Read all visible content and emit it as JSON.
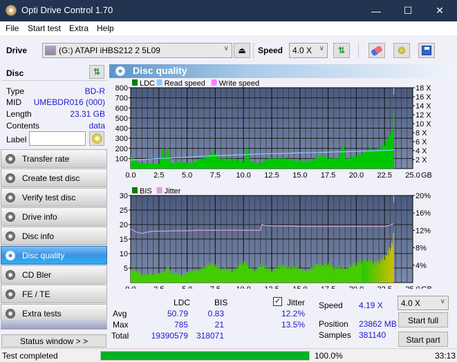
{
  "window": {
    "title": "Opti Drive Control 1.70",
    "minimize": "—",
    "maximize": "☐",
    "close": "✕"
  },
  "menu": [
    "File",
    "Start test",
    "Extra",
    "Help"
  ],
  "toolbar": {
    "drive_label": "Drive",
    "drive_value": "(G:)  ATAPI iHBS212  2 5L09",
    "speed_label": "Speed",
    "speed_value": "4.0 X",
    "icons": [
      "drive-icon",
      "eject-icon",
      "refresh-icon",
      "eraser-icon",
      "settings-icon",
      "save-icon"
    ]
  },
  "disc": {
    "title": "Disc",
    "type_label": "Type",
    "type_value": "BD-R",
    "mid_label": "MID",
    "mid_value": "UMEBDR016 (000)",
    "length_label": "Length",
    "length_value": "23.31 GB",
    "contents_label": "Contents",
    "contents_value": "data",
    "label_label": "Label",
    "label_value": ""
  },
  "nav": [
    {
      "label": "Transfer rate",
      "active": false
    },
    {
      "label": "Create test disc",
      "active": false
    },
    {
      "label": "Verify test disc",
      "active": false
    },
    {
      "label": "Drive info",
      "active": false
    },
    {
      "label": "Disc info",
      "active": false
    },
    {
      "label": "Disc quality",
      "active": true
    },
    {
      "label": "CD Bler",
      "active": false
    },
    {
      "label": "FE / TE",
      "active": false
    },
    {
      "label": "Extra tests",
      "active": false
    }
  ],
  "status_window_label": "Status window > >",
  "panel_title": "Disc quality",
  "chart_data": [
    {
      "type": "bar",
      "title": "LDC chart",
      "legend": [
        "LDC",
        "Read speed",
        "Write speed"
      ],
      "legend_colors": [
        "#008000",
        "#87cefa",
        "#ff80ff"
      ],
      "xlabel": "GB",
      "x_ticks": [
        "0.0",
        "2.5",
        "5.0",
        "7.5",
        "10.0",
        "12.5",
        "15.0",
        "17.5",
        "20.0",
        "22.5",
        "25.0"
      ],
      "xlim": [
        0,
        25
      ],
      "ylim": [
        0,
        800
      ],
      "y_ticks": [
        "100",
        "200",
        "300",
        "400",
        "500",
        "600",
        "700",
        "800"
      ],
      "y2_ticks": [
        "2 X",
        "4 X",
        "6 X",
        "8 X",
        "10 X",
        "12 X",
        "14 X",
        "16 X",
        "18 X"
      ],
      "y2lim": [
        0,
        18
      ],
      "series": [
        {
          "name": "LDC",
          "x": [
            0,
            0.5,
            1,
            1.5,
            2,
            2.5,
            2.8,
            3,
            3.2,
            3.5,
            4,
            4.5,
            5,
            5.5,
            6,
            6.5,
            7,
            7.3,
            7.5,
            8,
            8.5,
            9,
            9.5,
            10,
            10.3,
            10.5,
            11,
            11.5,
            11.8,
            12,
            12.5,
            13,
            13.5,
            14,
            14.5,
            15,
            15.5,
            16,
            16.5,
            17,
            17.5,
            18,
            18.5,
            18.8,
            19,
            19.5,
            20,
            20.5,
            21,
            21.2,
            21.5,
            22,
            22.3,
            22.6,
            23,
            23.2,
            23.31
          ],
          "values": [
            150,
            80,
            60,
            70,
            65,
            70,
            310,
            80,
            320,
            70,
            75,
            90,
            70,
            100,
            130,
            140,
            170,
            220,
            160,
            130,
            140,
            150,
            110,
            90,
            280,
            90,
            80,
            70,
            130,
            140,
            150,
            130,
            120,
            110,
            100,
            120,
            110,
            130,
            140,
            160,
            120,
            140,
            170,
            420,
            130,
            150,
            160,
            170,
            240,
            280,
            250,
            300,
            350,
            380,
            450,
            500,
            785
          ]
        },
        {
          "name": "Read speed",
          "x": [
            0,
            1,
            2,
            3,
            4,
            5,
            6,
            7,
            8,
            9,
            10,
            11,
            12,
            13,
            14,
            15,
            16,
            17,
            18,
            19,
            20,
            21,
            22,
            23,
            23.31
          ],
          "values": [
            1.9,
            2.0,
            2.2,
            2.3,
            2.4,
            2.5,
            2.7,
            2.8,
            2.9,
            3.0,
            3.1,
            3.2,
            3.3,
            3.35,
            3.4,
            3.5,
            3.55,
            3.6,
            3.7,
            3.75,
            3.85,
            3.9,
            4.0,
            4.1,
            4.19
          ]
        }
      ]
    },
    {
      "type": "bar",
      "title": "BIS chart",
      "legend": [
        "BIS",
        "Jitter"
      ],
      "legend_colors": [
        "#008000",
        "#d8a0d8"
      ],
      "xlabel": "GB",
      "x_ticks": [
        "0.0",
        "2.5",
        "5.0",
        "7.5",
        "10.0",
        "12.5",
        "15.0",
        "17.5",
        "20.0",
        "22.5",
        "25.0"
      ],
      "xlim": [
        0,
        25
      ],
      "ylim": [
        0,
        30
      ],
      "y_ticks": [
        "5",
        "10",
        "15",
        "20",
        "25",
        "30"
      ],
      "y2_ticks": [
        "4%",
        "8%",
        "12%",
        "16%",
        "20%"
      ],
      "y2lim": [
        0,
        20
      ],
      "series": [
        {
          "name": "BIS",
          "x": [
            0,
            0.5,
            1,
            1.5,
            2,
            2.5,
            3,
            3.2,
            3.5,
            4,
            4.5,
            5,
            5.5,
            6,
            6.5,
            7,
            7.5,
            8,
            8.5,
            9,
            9.5,
            10,
            10.5,
            11,
            11.5,
            12,
            12.5,
            13,
            13.5,
            14,
            14.5,
            15,
            15.5,
            16,
            16.5,
            17,
            17.5,
            18,
            18.5,
            19,
            19.5,
            20,
            20.5,
            21,
            21.5,
            22,
            22.3,
            22.6,
            23,
            23.2,
            23.31
          ],
          "values": [
            6,
            5,
            3,
            4,
            4,
            5,
            5,
            8,
            4,
            4,
            3,
            5,
            6,
            6,
            7,
            8,
            7,
            6,
            7,
            6,
            8,
            9,
            6,
            5,
            9,
            8,
            6,
            7,
            7,
            6,
            7,
            7,
            6,
            7,
            8,
            7,
            8,
            7,
            8,
            7,
            8,
            8,
            9,
            10,
            10,
            11,
            12,
            13,
            15,
            18,
            21
          ]
        },
        {
          "name": "Jitter",
          "x": [
            0,
            0.5,
            1,
            1.5,
            2,
            3,
            4,
            5,
            6,
            7,
            8,
            9,
            10,
            11,
            11.5,
            11.6,
            12,
            13,
            14,
            15,
            16,
            17,
            18,
            19,
            20,
            21,
            22,
            22.5,
            23,
            23.31
          ],
          "values": [
            12.3,
            11.6,
            11.3,
            11.6,
            11.8,
            11.8,
            11.9,
            11.9,
            12.0,
            12.0,
            12.0,
            12.0,
            12.0,
            12.0,
            12.0,
            13.3,
            13.1,
            13.0,
            13.0,
            12.9,
            12.9,
            12.9,
            12.9,
            12.9,
            12.9,
            12.9,
            12.9,
            12.9,
            13.2,
            13.5
          ]
        }
      ]
    }
  ],
  "stats": {
    "col_ldc": "LDC",
    "col_bis": "BIS",
    "jitter_label": "Jitter",
    "jitter_checked": true,
    "avg_label": "Avg",
    "avg_ldc": "50.79",
    "avg_bis": "0.83",
    "avg_jitter": "12.2%",
    "max_label": "Max",
    "max_ldc": "785",
    "max_bis": "21",
    "max_jitter": "13.5%",
    "total_label": "Total",
    "total_ldc": "19390579",
    "total_bis": "318071",
    "speed_label": "Speed",
    "speed_value": "4.19 X",
    "position_label": "Position",
    "position_value": "23862 MB",
    "samples_label": "Samples",
    "samples_value": "381140",
    "speed_select": "4.0 X",
    "start_full": "Start full",
    "start_part": "Start part"
  },
  "status": {
    "text": "Test completed",
    "progress": 100.0,
    "progress_label": "100.0%",
    "time": "33:13"
  }
}
